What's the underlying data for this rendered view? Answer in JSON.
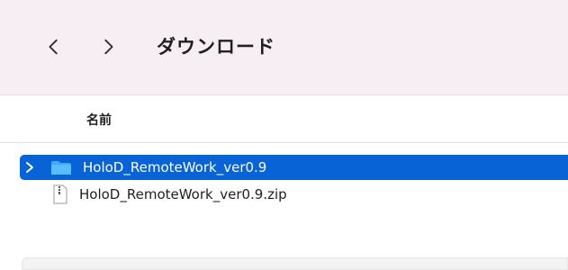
{
  "toolbar": {
    "back_icon": "chevron-left-icon",
    "forward_icon": "chevron-right-icon",
    "title": "ダウンロード"
  },
  "header": {
    "name_column": "名前"
  },
  "files": [
    {
      "name": "HoloD_RemoteWork_ver0.9",
      "type": "folder",
      "selected": true
    },
    {
      "name": "HoloD_RemoteWork_ver0.9.zip",
      "type": "zip",
      "selected": false
    }
  ],
  "colors": {
    "toolbar_bg": "#f7eef3",
    "selection": "#0863d6",
    "folder": "#3fa9f5"
  }
}
